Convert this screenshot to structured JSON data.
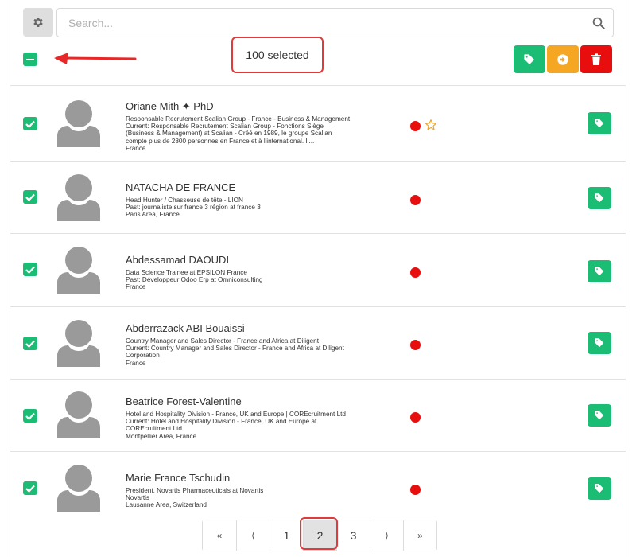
{
  "toolbar": {
    "search_placeholder": "Search...",
    "selected_count_text": "100 selected",
    "accent_green": "#1bbc74",
    "accent_orange": "#f5a623",
    "accent_red": "#e80e0e"
  },
  "profiles": [
    {
      "name": "Oriane Mith ✦ PhD",
      "lines": [
        "Responsable Recrutement Scalian Group - France - Business & Management",
        "Current: Responsable Recrutement Scalian Group - Fonctions Siège",
        "(Business & Management) at Scalian - Créé en 1989, le groupe Scalian",
        "compte plus de 2800 personnes en France et à l'international. Il...",
        "France"
      ],
      "status_color": "#e80e0e",
      "starred": true
    },
    {
      "name": "NATACHA DE FRANCE",
      "lines": [
        "Head Hunter / Chasseuse de tête - LION",
        "Past: journaliste sur france 3 région at france 3",
        "Paris Area, France"
      ],
      "status_color": "#e80e0e",
      "starred": false
    },
    {
      "name": "Abdessamad DAOUDI",
      "lines": [
        "Data Science Trainee at EPSILON France",
        "Past: Développeur Odoo Erp at Omniconsulting",
        "France"
      ],
      "status_color": "#e80e0e",
      "starred": false
    },
    {
      "name": "Abderrazack ABI Bouaissi",
      "lines": [
        "Country Manager and Sales Director - France and Africa at Diligent",
        "Current: Country Manager and Sales Director - France and Africa at Diligent",
        "Corporation",
        "France"
      ],
      "status_color": "#e80e0e",
      "starred": false
    },
    {
      "name": "Beatrice Forest-Valentine",
      "lines": [
        "Hotel and Hospitality Division - France, UK and Europe | COREcruitment Ltd",
        "Current: Hotel and Hospitality Division - France, UK and Europe at",
        "COREcruitment Ltd",
        "Montpellier Area, France"
      ],
      "status_color": "#e80e0e",
      "starred": false
    },
    {
      "name": "Marie France Tschudin",
      "lines": [
        "President, Novartis Pharmaceuticals at Novartis",
        "Novartis",
        "Lausanne Area, Switzerland"
      ],
      "status_color": "#e80e0e",
      "starred": false
    }
  ],
  "pagination": {
    "first": "«",
    "prev": "⟨",
    "pages": [
      "1",
      "2",
      "3"
    ],
    "current": "2",
    "next": "⟩",
    "last": "»"
  }
}
